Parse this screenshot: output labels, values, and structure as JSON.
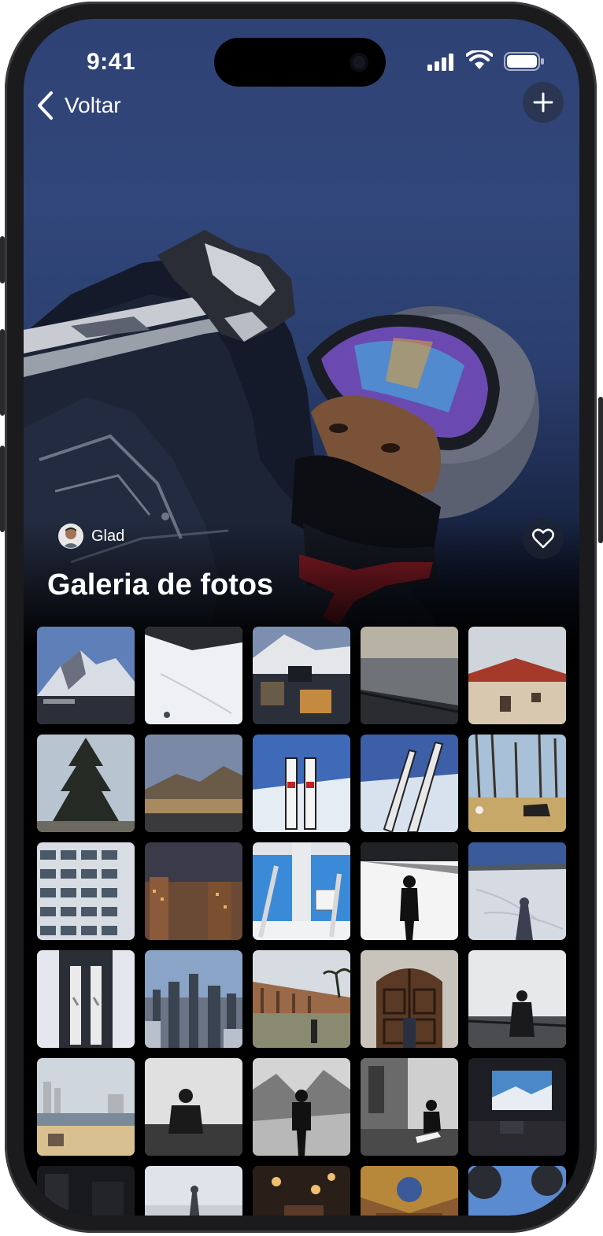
{
  "status_bar": {
    "time": "9:41"
  },
  "nav": {
    "back_label": "Voltar",
    "add_icon": "plus-icon"
  },
  "hero": {
    "author": "Glad",
    "favorite_icon": "heart-icon"
  },
  "page": {
    "title": "Galeria de fotos"
  },
  "gallery": {
    "photos": [
      "mountain-peak",
      "snowy-slope",
      "ski-lodge-table",
      "sea-pier",
      "red-roof-house",
      "pine-tree",
      "desert-hills",
      "skis-in-snow",
      "skis-closeup",
      "horse-in-park",
      "apartment-building",
      "city-night",
      "lift-window",
      "skier-silhouette",
      "shadow-on-snow",
      "skis-top-view",
      "city-skyline",
      "colonnade-walk",
      "arched-door",
      "person-on-pier",
      "beach-city",
      "person-portrait",
      "mountain-portrait",
      "seated-person",
      "restaurant-window",
      "dark-interior",
      "statue-sky",
      "restaurant-lights",
      "ornate-ceiling",
      "city-reflection"
    ]
  }
}
